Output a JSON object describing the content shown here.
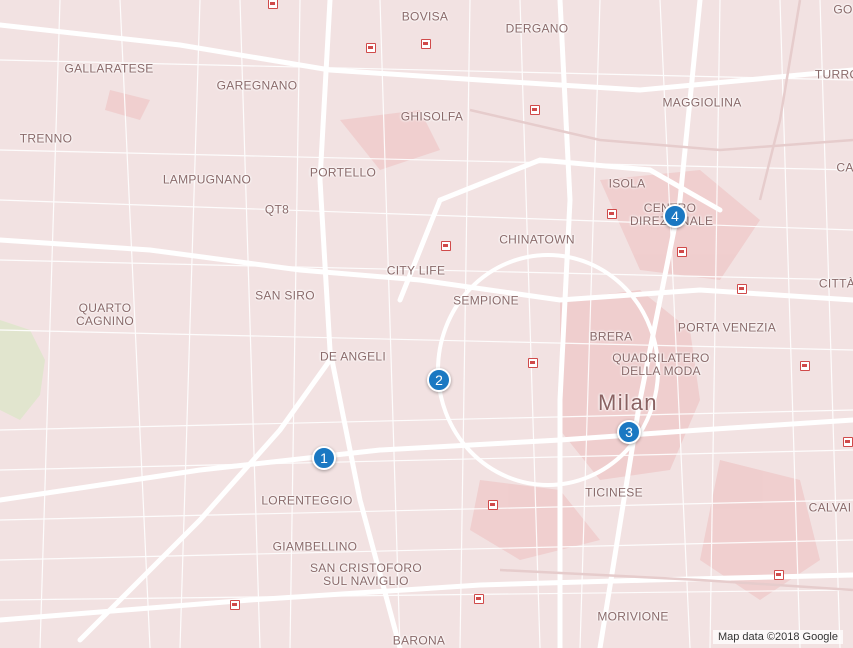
{
  "map": {
    "city_label": "Milan",
    "attribution": "Map data ©2018 Google",
    "colors": {
      "background": "#f2e2e2",
      "road": "#ffffff",
      "district_fill": "#f0c9c9",
      "park": "#d9e3c8",
      "pin": "#1a78c2",
      "metro": "#d04a4a"
    },
    "markers": [
      {
        "label": "1"
      },
      {
        "label": "2"
      },
      {
        "label": "3"
      },
      {
        "label": "4"
      }
    ],
    "place_labels": [
      "BOVISA",
      "DERGANO",
      "GALLARATESE",
      "GAREGNANO",
      "GHISOLFA",
      "MAGGIOLINA",
      "TRENNO",
      "LAMPUGNANO",
      "PORTELLO",
      "ISOLA",
      "QT8",
      "CENTRO DIREZIONALE",
      "CHINATOWN",
      "CITY LIFE",
      "SAN SIRO",
      "SEMPIONE",
      "QUARTO CAGNINO",
      "BRERA",
      "PORTA VENEZIA",
      "DE ANGELI",
      "QUADRILATERO DELLA MODA",
      "LORENTEGGIO",
      "TICINESE",
      "GIAMBELLINO",
      "SAN CRISTOFORO SUL NAVIGLIO",
      "MORIVIONE",
      "BARONA",
      "TURRO",
      "CITTÀ",
      "CALVAI",
      "GO",
      "CA"
    ]
  }
}
